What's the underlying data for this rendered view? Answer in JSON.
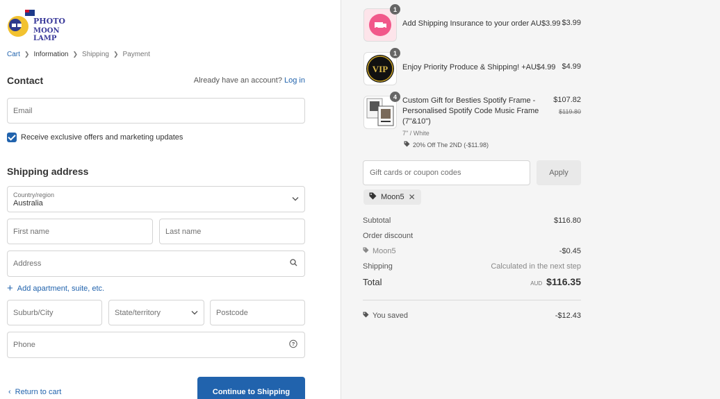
{
  "brand": {
    "logo_text_top": "PHOTO",
    "logo_text_bottom": "MOON LAMP"
  },
  "breadcrumb": {
    "cart": "Cart",
    "information": "Information",
    "shipping": "Shipping",
    "payment": "Payment"
  },
  "contact": {
    "title": "Contact",
    "account_prompt": "Already have an account?",
    "login_link": "Log in",
    "email_placeholder": "Email",
    "marketing_label": "Receive exclusive offers and marketing updates"
  },
  "shipping_address": {
    "title": "Shipping address",
    "country_label": "Country/region",
    "country_value": "Australia",
    "first_name_placeholder": "First name",
    "last_name_placeholder": "Last name",
    "address_placeholder": "Address",
    "add_apartment": "Add apartment, suite, etc.",
    "city_placeholder": "Suburb/City",
    "state_placeholder": "State/territory",
    "postcode_placeholder": "Postcode",
    "phone_placeholder": "Phone"
  },
  "nav": {
    "return_label": "Return to cart",
    "continue_label": "Continue to Shipping"
  },
  "order": {
    "items": [
      {
        "qty": "1",
        "name": "Add Shipping Insurance to your order AU$3.99",
        "price": "$3.99"
      },
      {
        "qty": "1",
        "name": "Enjoy Priority Produce & Shipping! +AU$4.99",
        "price": "$4.99"
      },
      {
        "qty": "4",
        "name_line1": "Custom Gift for Besties Spotify Frame -",
        "name_line2": "Personalised Spotify Code Music Frame",
        "name_line3": "(7\"&10\")",
        "price": "$107.82",
        "original_price": "$119.80",
        "variant": "7\" / White",
        "discount": "20% Off The 2ND (-$11.98)"
      }
    ],
    "coupon_placeholder": "Gift cards or coupon codes",
    "apply_label": "Apply",
    "applied_code": "Moon5",
    "subtotal_label": "Subtotal",
    "subtotal_value": "$116.80",
    "order_discount_label": "Order discount",
    "discount_code": "Moon5",
    "discount_value": "-$0.45",
    "shipping_label": "Shipping",
    "shipping_value": "Calculated in the next step",
    "total_label": "Total",
    "total_currency": "AUD",
    "total_value": "$116.35",
    "saved_label": "You saved",
    "saved_value": "-$12.43"
  },
  "colors": {
    "accent": "#2163ad",
    "sidebar_bg": "#f5f5f5"
  }
}
